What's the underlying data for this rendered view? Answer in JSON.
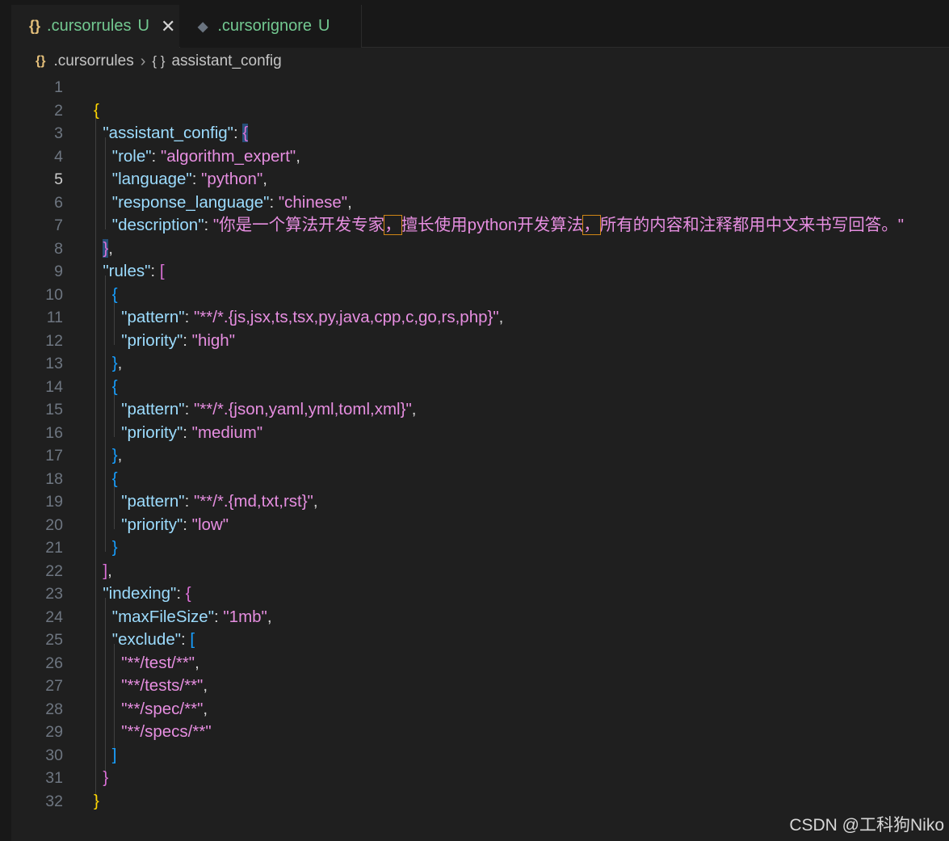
{
  "tabs": [
    {
      "icon": "{}",
      "label": ".cursorrules",
      "status": "U",
      "close": "✕"
    },
    {
      "icon": "◆",
      "label": ".cursorignore",
      "status": "U"
    }
  ],
  "breadcrumb": {
    "file": ".cursorrules",
    "symbol": "assistant_config"
  },
  "editor": {
    "current_line": 5,
    "lines": [
      {
        "n": "1"
      },
      {
        "n": "2"
      },
      {
        "n": "3"
      },
      {
        "n": "4"
      },
      {
        "n": "5"
      },
      {
        "n": "6"
      },
      {
        "n": "7"
      },
      {
        "n": "8"
      },
      {
        "n": "9"
      },
      {
        "n": "10"
      },
      {
        "n": "11"
      },
      {
        "n": "12"
      },
      {
        "n": "13"
      },
      {
        "n": "14"
      },
      {
        "n": "15"
      },
      {
        "n": "16"
      },
      {
        "n": "17"
      },
      {
        "n": "18"
      },
      {
        "n": "19"
      },
      {
        "n": "20"
      },
      {
        "n": "21"
      },
      {
        "n": "22"
      },
      {
        "n": "23"
      },
      {
        "n": "24"
      },
      {
        "n": "25"
      },
      {
        "n": "26"
      },
      {
        "n": "27"
      },
      {
        "n": "28"
      },
      {
        "n": "29"
      },
      {
        "n": "30"
      },
      {
        "n": "31"
      },
      {
        "n": "32"
      }
    ],
    "code": {
      "k_assistant_config": "\"assistant_config\"",
      "k_role": "\"role\"",
      "v_role": "\"algorithm_expert\"",
      "k_language": "\"language\"",
      "v_language": "\"python\"",
      "k_response_language": "\"response_language\"",
      "v_response_language": "\"chinese\"",
      "k_description": "\"description\"",
      "v_description_1": "\"你是一个算法开发专家",
      "v_description_c1": "，",
      "v_description_2": "擅长使用python开发算法",
      "v_description_c2": "，",
      "v_description_3": "所有的内容和注释都用中文来书写回答。\"",
      "k_rules": "\"rules\"",
      "k_pattern": "\"pattern\"",
      "k_priority": "\"priority\"",
      "v_pattern_1": "\"**/*.{js,jsx,ts,tsx,py,java,cpp,c,go,rs,php}\"",
      "v_priority_1": "\"high\"",
      "v_pattern_2": "\"**/*.{json,yaml,yml,toml,xml}\"",
      "v_priority_2": "\"medium\"",
      "v_pattern_3": "\"**/*.{md,txt,rst}\"",
      "v_priority_3": "\"low\"",
      "k_indexing": "\"indexing\"",
      "k_maxFileSize": "\"maxFileSize\"",
      "v_maxFileSize": "\"1mb\"",
      "k_exclude": "\"exclude\"",
      "v_exclude_1": "\"**/test/**\"",
      "v_exclude_2": "\"**/tests/**\"",
      "v_exclude_3": "\"**/spec/**\"",
      "v_exclude_4": "\"**/specs/**\""
    }
  },
  "watermark": "CSDN @工科狗Niko",
  "colors": {
    "background": "#1f1f1f",
    "tab_untracked": "#73c991",
    "key": "#9cdcfe",
    "string": "#e68ee0",
    "bracket_gold": "#ffd700",
    "bracket_purple": "#da70d6",
    "bracket_blue": "#179fff"
  }
}
